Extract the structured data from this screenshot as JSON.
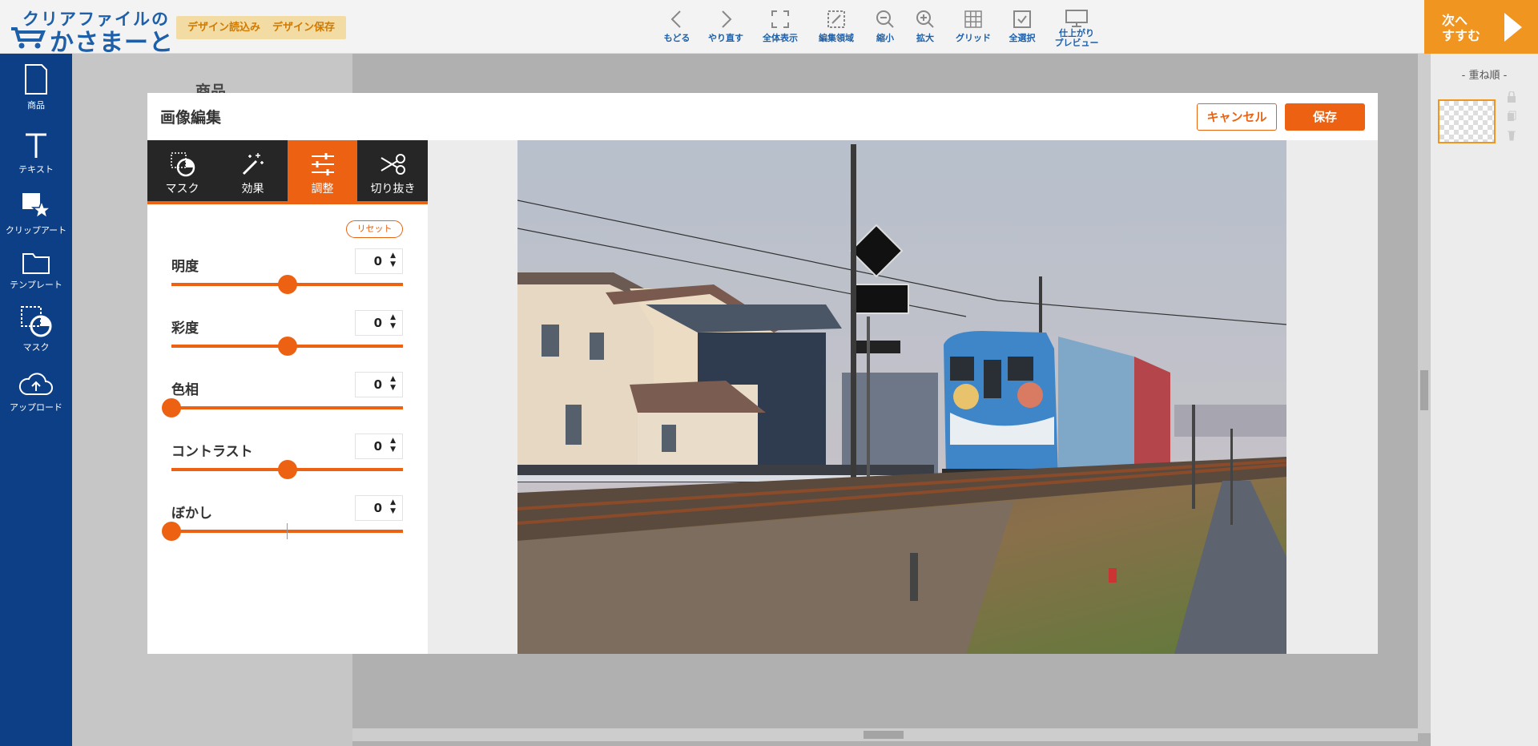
{
  "header": {
    "logo_top": "クリアファイルの",
    "logo_bottom": "かさまーと",
    "load_design": "デザイン読込み",
    "save_design": "デザイン保存",
    "tools": [
      {
        "label": "もどる",
        "icon": "chevron-left-icon"
      },
      {
        "label": "やり直す",
        "icon": "chevron-right-icon"
      },
      {
        "label": "全体表示",
        "icon": "fit-screen-icon"
      },
      {
        "label": "編集領域",
        "icon": "edit-area-icon"
      },
      {
        "label": "縮小",
        "icon": "zoom-out-icon"
      },
      {
        "label": "拡大",
        "icon": "zoom-in-icon"
      },
      {
        "label": "グリッド",
        "icon": "grid-icon"
      },
      {
        "label": "全選択",
        "icon": "select-all-icon"
      },
      {
        "label": "仕上がり",
        "label2": "プレビュー",
        "icon": "monitor-icon"
      }
    ],
    "next_line1": "次へ",
    "next_line2": "すすむ"
  },
  "sidebar": {
    "items": [
      {
        "label": "商品",
        "icon": "product-icon"
      },
      {
        "label": "テキスト",
        "icon": "text-icon"
      },
      {
        "label": "クリップアート",
        "icon": "clipart-icon"
      },
      {
        "label": "テンプレート",
        "icon": "folder-icon"
      },
      {
        "label": "マスク",
        "icon": "mask-icon"
      },
      {
        "label": "アップロード",
        "icon": "upload-cloud-icon"
      }
    ]
  },
  "left_panel_title": "商品",
  "layers": {
    "title": "- 重ね順 -"
  },
  "modal": {
    "title": "画像編集",
    "cancel": "キャンセル",
    "save": "保存",
    "tabs": [
      {
        "label": "マスク",
        "icon": "mask-icon"
      },
      {
        "label": "効果",
        "icon": "magic-wand-icon"
      },
      {
        "label": "調整",
        "icon": "sliders-icon",
        "active": true
      },
      {
        "label": "切り抜き",
        "icon": "scissors-icon"
      }
    ],
    "reset": "リセット",
    "adjustments": [
      {
        "label": "明度",
        "value": "0",
        "level": 0.5
      },
      {
        "label": "彩度",
        "value": "0",
        "level": 0.5
      },
      {
        "label": "色相",
        "value": "0",
        "level": 0.0
      },
      {
        "label": "コントラスト",
        "value": "0",
        "level": 0.5
      },
      {
        "label": "ぼかし",
        "value": "0",
        "level": 0.0
      }
    ]
  },
  "colors": {
    "accent": "#ed6212",
    "brand": "#0d3f86",
    "next": "#f0951f"
  }
}
